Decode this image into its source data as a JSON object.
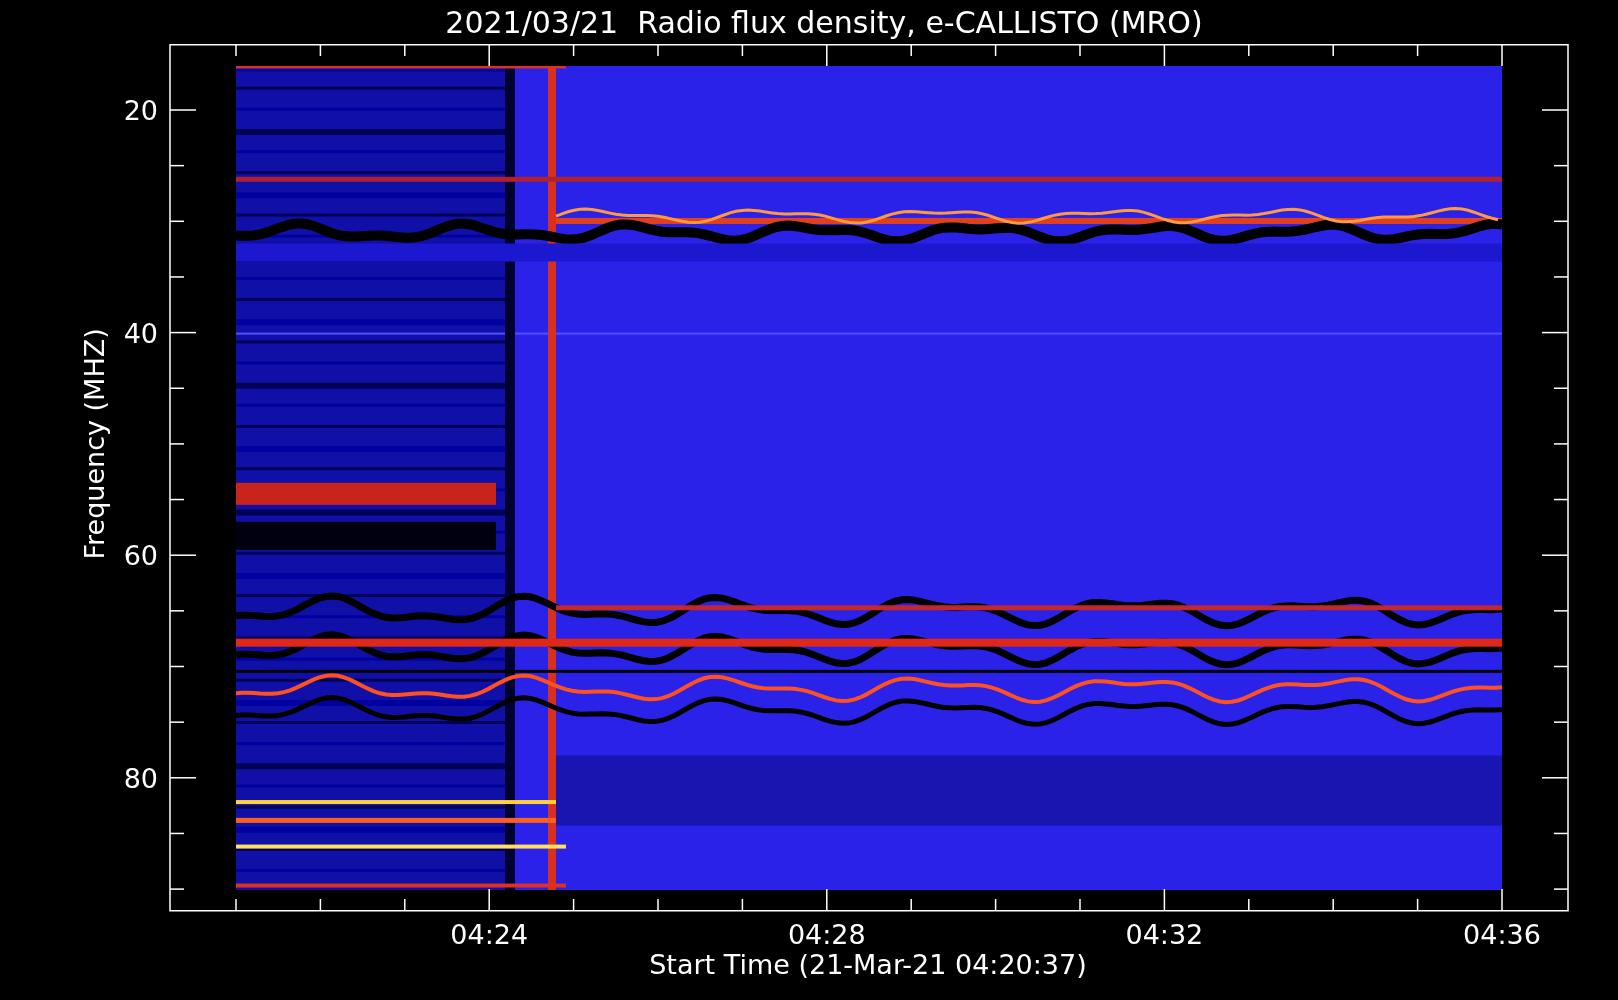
{
  "title": "2021/03/21  Radio flux density, e-CALLISTO (MRO)",
  "y_axis": {
    "title": "Frequency (MHZ)",
    "tick_labels": [
      "20",
      "40",
      "60",
      "80"
    ]
  },
  "x_axis": {
    "title": "Start Time (21-Mar-21 04:20:37)",
    "tick_labels": [
      "04:24",
      "04:28",
      "04:32",
      "04:36"
    ]
  }
}
